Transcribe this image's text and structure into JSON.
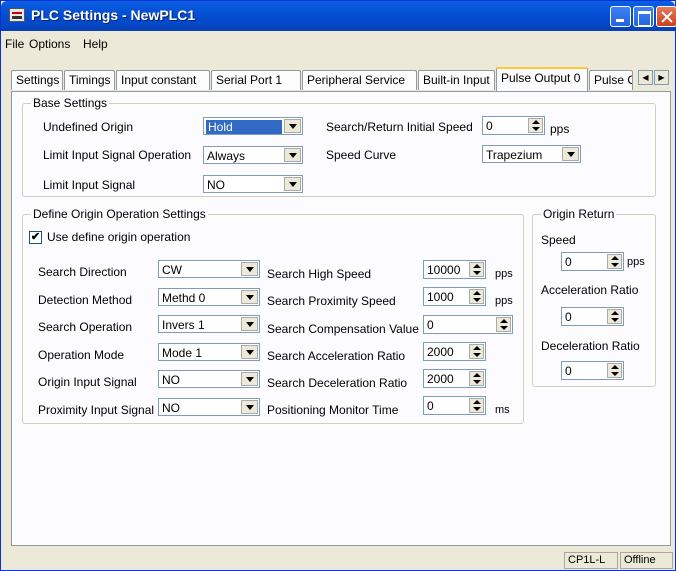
{
  "window": {
    "title": "PLC Settings - NewPLC1"
  },
  "menu": [
    "File",
    "Options",
    "Help"
  ],
  "tabs": [
    "Settings",
    "Timings",
    "Input constant",
    "Serial Port 1",
    "Peripheral Service",
    "Built-in Input",
    "Pulse Output 0",
    "Pulse O"
  ],
  "base_settings": {
    "title": "Base Settings",
    "undefined_origin": {
      "label": "Undefined Origin",
      "value": "Hold"
    },
    "limit_input_signal_operation": {
      "label": "Limit Input Signal Operation",
      "value": "Always"
    },
    "limit_input_signal": {
      "label": "Limit Input Signal",
      "value": "NO"
    },
    "search_return_initial_speed": {
      "label": "Search/Return Initial Speed",
      "value": "0",
      "unit": "pps"
    },
    "speed_curve": {
      "label": "Speed Curve",
      "value": "Trapezium"
    }
  },
  "define_origin": {
    "title": "Define Origin Operation Settings",
    "use_checkbox_label": "Use define origin operation",
    "search_direction": {
      "label": "Search Direction",
      "value": "CW"
    },
    "detection_method": {
      "label": "Detection Method",
      "value": "Methd 0"
    },
    "search_operation": {
      "label": "Search Operation",
      "value": "Invers 1"
    },
    "operation_mode": {
      "label": "Operation Mode",
      "value": "Mode 1"
    },
    "origin_input_signal": {
      "label": "Origin Input Signal",
      "value": "NO"
    },
    "proximity_input_signal": {
      "label": "Proximity Input Signal",
      "value": "NO"
    },
    "search_high_speed": {
      "label": "Search High Speed",
      "value": "10000",
      "unit": "pps"
    },
    "search_proximity_speed": {
      "label": "Search Proximity Speed",
      "value": "1000",
      "unit": "pps"
    },
    "search_compensation_value": {
      "label": "Search Compensation Value",
      "value": "0"
    },
    "search_acceleration_ratio": {
      "label": "Search Acceleration Ratio",
      "value": "2000"
    },
    "search_deceleration_ratio": {
      "label": "Search Deceleration Ratio",
      "value": "2000"
    },
    "positioning_monitor_time": {
      "label": "Positioning Monitor Time",
      "value": "0",
      "unit": "ms"
    }
  },
  "origin_return": {
    "title": "Origin Return",
    "speed": {
      "label": "Speed",
      "value": "0",
      "unit": "pps"
    },
    "acceleration_ratio": {
      "label": "Acceleration Ratio",
      "value": "0"
    },
    "deceleration_ratio": {
      "label": "Deceleration Ratio",
      "value": "0"
    }
  },
  "status": {
    "model": "CP1L-L",
    "state": "Offline"
  },
  "colors": {
    "title_bar": "#0450d4",
    "selection": "#316ac5",
    "active_tab_accent": "#ffc83c"
  }
}
